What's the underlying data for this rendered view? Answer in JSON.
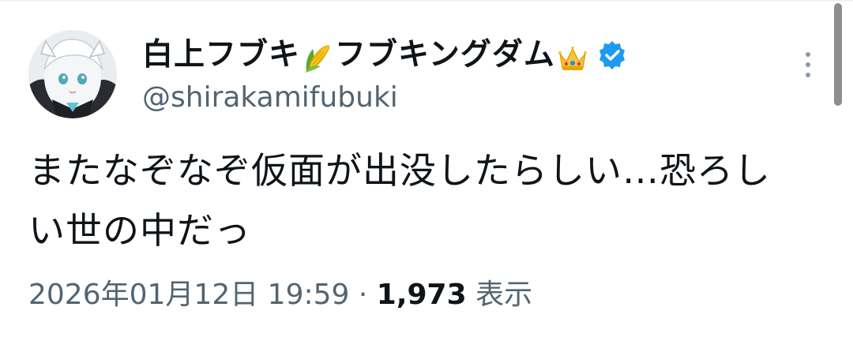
{
  "tweet": {
    "display_name_part1": "白上フブキ",
    "emoji_1": "corn-emoji",
    "display_name_part2": "フブキングダム",
    "emoji_2": "crown-emoji",
    "verified_icon": "verified-badge-icon",
    "handle": "@shirakamifubuki",
    "text_line1": "またなぞなぞ仮面が出没したらしい…恐ろし",
    "text_line2": "い世の中だっ",
    "timestamp": "2026年01月12日 19:59",
    "separator": " · ",
    "views_count": "1,973",
    "views_label": "表示"
  },
  "colors": {
    "text_primary": "#0f1419",
    "text_secondary": "#536471",
    "verified_blue": "#1d9bf0"
  }
}
